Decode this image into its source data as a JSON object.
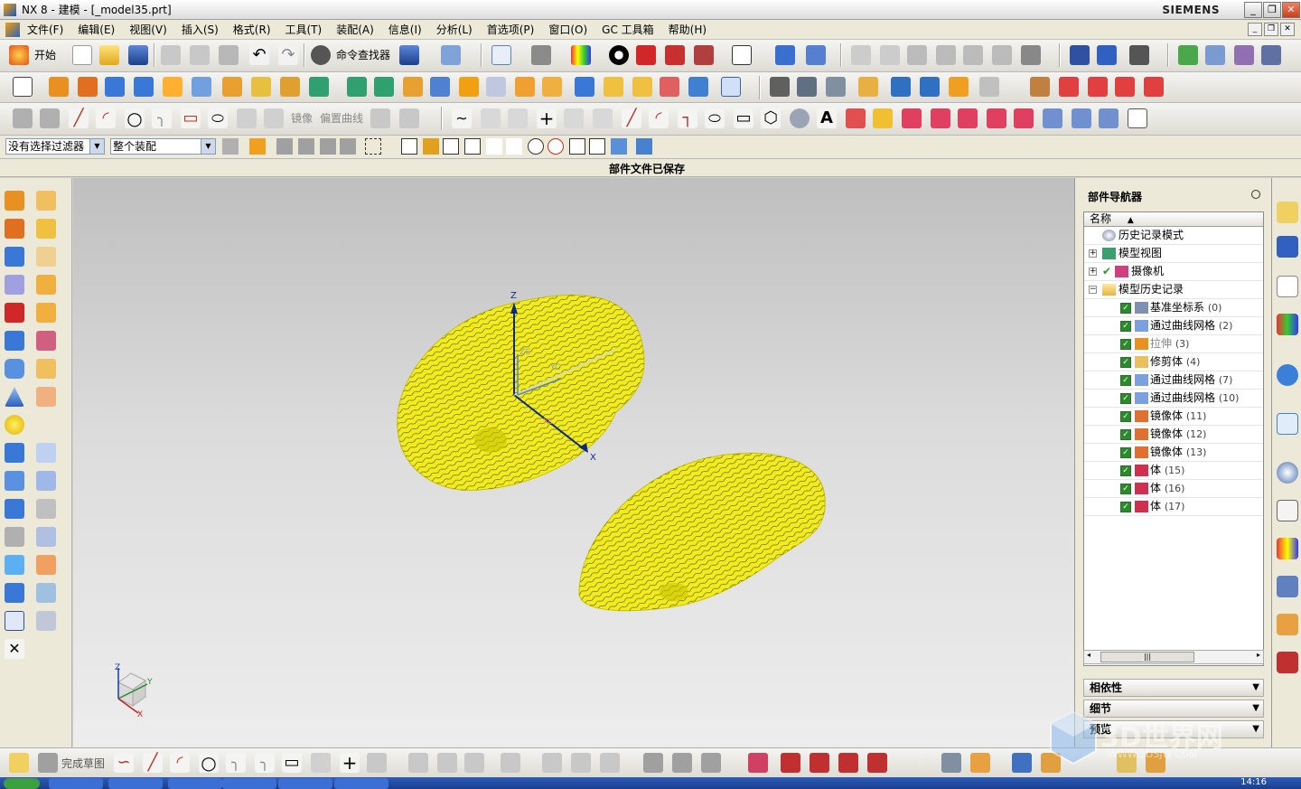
{
  "window": {
    "title": "NX 8 - 建模 - [_model35.prt]",
    "brand": "SIEMENS",
    "controls": [
      "_",
      "❐",
      "✕"
    ]
  },
  "menubar": {
    "items": [
      "文件(F)",
      "编辑(E)",
      "视图(V)",
      "插入(S)",
      "格式(R)",
      "工具(T)",
      "装配(A)",
      "信息(I)",
      "分析(L)",
      "首选项(P)",
      "窗口(O)",
      "GC 工具箱",
      "帮助(H)"
    ]
  },
  "toolbar1": {
    "start_label": "开始",
    "command_finder_label": "命令查找器"
  },
  "sketch_toolbar": {
    "mirror_label": "镜像",
    "offset_curve_label": "偏置曲线"
  },
  "selection_bar": {
    "filter_value": "没有选择过滤器",
    "scope_value": "整个装配"
  },
  "status": {
    "message": "部件文件已保存"
  },
  "part_navigator": {
    "header": "部件导航器",
    "column_name": "名称",
    "sort_indicator": "▲",
    "top_nodes": [
      {
        "label": "历史记录模式"
      },
      {
        "label": "模型视图"
      },
      {
        "label": "摄像机"
      },
      {
        "label": "模型历史记录"
      }
    ],
    "features": [
      {
        "label": "基准坐标系",
        "num": "(0)"
      },
      {
        "label": "通过曲线网格",
        "num": "(2)"
      },
      {
        "label": "拉伸",
        "num": "(3)"
      },
      {
        "label": "修剪体",
        "num": "(4)"
      },
      {
        "label": "通过曲线网格",
        "num": "(7)"
      },
      {
        "label": "通过曲线网格",
        "num": "(10)"
      },
      {
        "label": "镜像体",
        "num": "(11)"
      },
      {
        "label": "镜像体",
        "num": "(12)"
      },
      {
        "label": "镜像体",
        "num": "(13)"
      },
      {
        "label": "体",
        "num": "(15)"
      },
      {
        "label": "体",
        "num": "(16)"
      },
      {
        "label": "体",
        "num": "(17)"
      }
    ],
    "sections": [
      "相依性",
      "细节",
      "预览"
    ]
  },
  "bottom_toolbar": {
    "finish_sketch_label": "完成草图"
  },
  "viewport": {
    "triad_labels": {
      "z": "Z",
      "y": "Y",
      "x": "X"
    },
    "datum_labels": {
      "zc": "ZC",
      "yc": "YC",
      "xc": "XC"
    },
    "body_color": "#f2ec1b"
  },
  "taskbar": {
    "clock": "14:16"
  },
  "watermark": {
    "title": "3D世界网",
    "url": "WWW.3DSJW.COM"
  },
  "colors": {
    "accent_blue": "#2b62c4",
    "check_green": "#2b8a2b",
    "body_yellow": "#f2ec1b"
  }
}
